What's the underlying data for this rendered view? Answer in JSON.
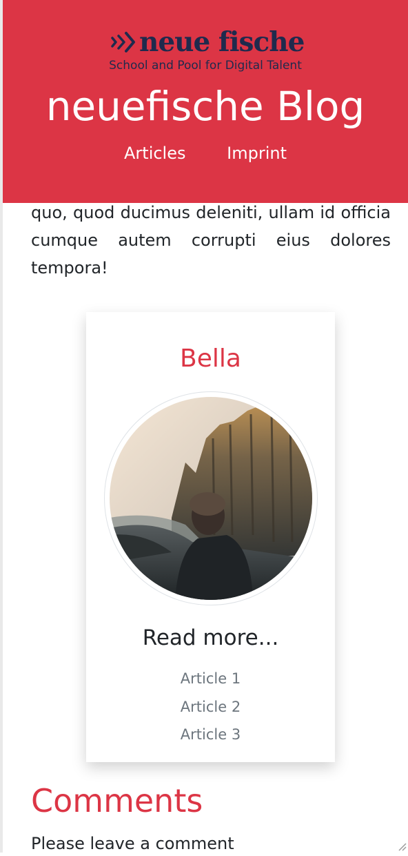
{
  "header": {
    "logo_text": "neue fische",
    "logo_tagline": "School and Pool for Digital Talent",
    "blog_title": "neuefische Blog",
    "nav": [
      {
        "label": "Articles"
      },
      {
        "label": "Imprint"
      }
    ]
  },
  "article": {
    "text_tail": "quo, quod ducimus deleniti, ullam id officia cumque autem corrupti eius dolores tempora!"
  },
  "author_card": {
    "name": "Bella",
    "image_icon": "person-in-forest-photo",
    "read_more": "Read more...",
    "articles": [
      {
        "label": "Article 1"
      },
      {
        "label": "Article 2"
      },
      {
        "label": "Article 3"
      }
    ]
  },
  "comments": {
    "title": "Comments",
    "prompt": "Please leave a comment"
  },
  "colors": {
    "brand_red": "#dc3545",
    "logo_navy": "#1f2a4d",
    "link_gray": "#6c757d"
  }
}
